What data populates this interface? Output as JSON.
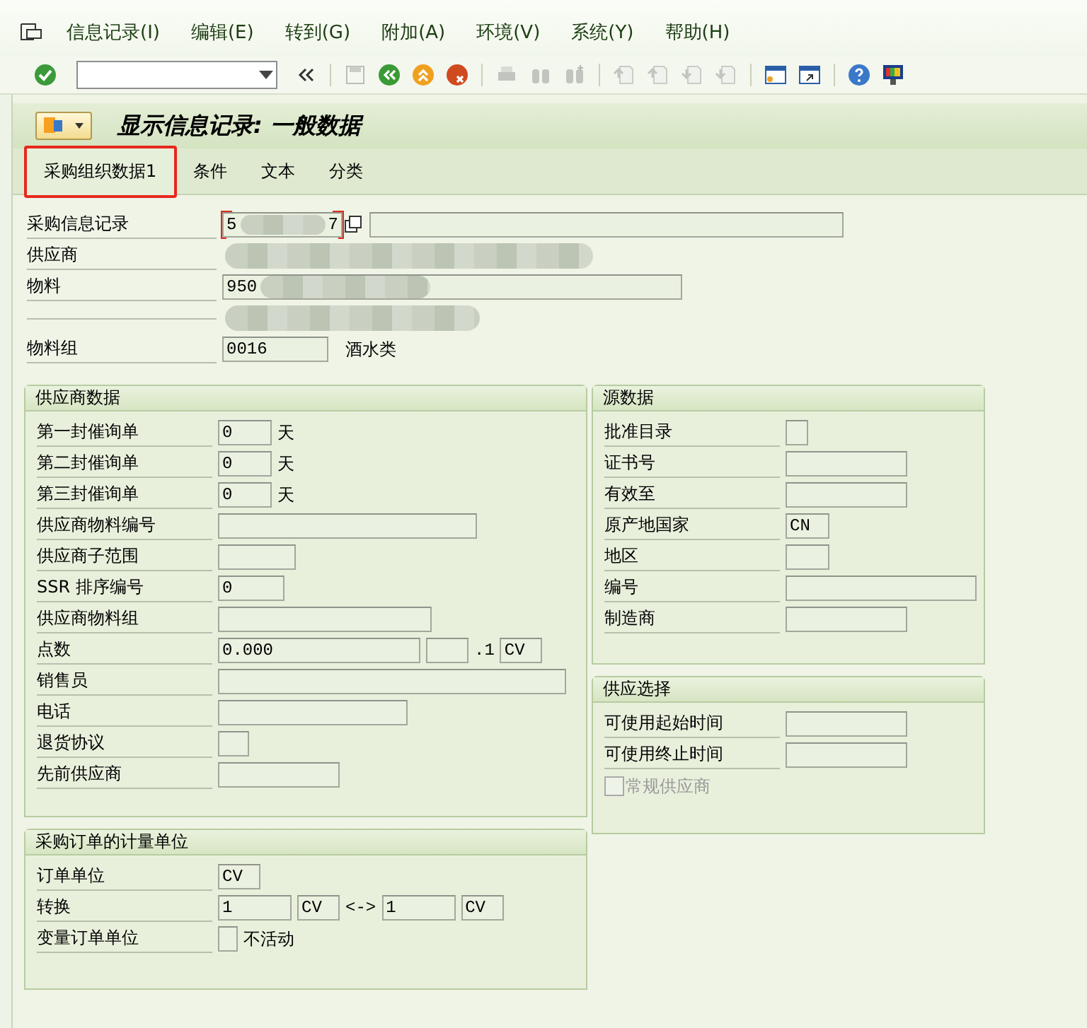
{
  "menu_bar": {
    "items": [
      {
        "label": "信息记录(I)"
      },
      {
        "label": "编辑(E)"
      },
      {
        "label": "转到(G)"
      },
      {
        "label": "附加(A)"
      },
      {
        "label": "环境(V)"
      },
      {
        "label": "系统(Y)"
      },
      {
        "label": "帮助(H)"
      }
    ]
  },
  "toolbar": {
    "buttons": [
      {
        "kind": "enter",
        "disabled": false
      },
      {
        "kind": "collapse",
        "disabled": false
      },
      {
        "kind": "save",
        "disabled": true
      },
      {
        "kind": "back",
        "disabled": false
      },
      {
        "kind": "exit",
        "disabled": false
      },
      {
        "kind": "cancel",
        "disabled": false
      },
      {
        "kind": "print",
        "disabled": true
      },
      {
        "kind": "find",
        "disabled": true
      },
      {
        "kind": "find-next",
        "disabled": true
      },
      {
        "kind": "first-page",
        "disabled": true
      },
      {
        "kind": "previous-page",
        "disabled": true
      },
      {
        "kind": "next-page",
        "disabled": true
      },
      {
        "kind": "last-page",
        "disabled": true
      },
      {
        "kind": "new-session",
        "disabled": false
      },
      {
        "kind": "shortcut",
        "disabled": false
      },
      {
        "kind": "help",
        "disabled": false
      },
      {
        "kind": "layout",
        "disabled": false
      }
    ]
  },
  "title": "显示信息记录: 一般数据",
  "tabs": [
    {
      "label": "采购组织数据1",
      "selected": true,
      "highlighted": true
    },
    {
      "label": "条件",
      "selected": false,
      "highlighted": false
    },
    {
      "label": "文本",
      "selected": false,
      "highlighted": false
    },
    {
      "label": "分类",
      "selected": false,
      "highlighted": false
    }
  ],
  "header": [
    {
      "label": "采购信息记录",
      "value_start": "5",
      "value_end": "7",
      "focused": true,
      "redacted": true
    },
    {
      "label": "供应商",
      "redacted": true
    },
    {
      "label": "物料",
      "value": "950",
      "redacted": true
    },
    {
      "redacted": true
    },
    {
      "label": "物料组",
      "value": "0016",
      "text": "酒水类"
    }
  ],
  "groups": [
    {
      "title": "供应商数据",
      "rows": [
        {
          "label": "第一封催询单",
          "parts": [
            {
              "kind": "input",
              "value": "0"
            },
            {
              "kind": "text",
              "text": "天"
            }
          ]
        },
        {
          "label": "第二封催询单",
          "parts": [
            {
              "kind": "input",
              "value": "0"
            },
            {
              "kind": "text",
              "text": "天"
            }
          ]
        },
        {
          "label": "第三封催询单",
          "parts": [
            {
              "kind": "input",
              "value": "0"
            },
            {
              "kind": "text",
              "text": "天"
            }
          ]
        },
        {
          "label": "供应商物料编号",
          "parts": [
            {
              "kind": "input"
            }
          ]
        },
        {
          "label": "供应商子范围",
          "parts": [
            {
              "kind": "input"
            }
          ]
        },
        {
          "label": "SSR 排序编号",
          "parts": [
            {
              "kind": "input",
              "value": "0"
            }
          ]
        },
        {
          "label": "供应商物料组",
          "parts": [
            {
              "kind": "input"
            }
          ]
        },
        {
          "label": "点数",
          "parts": [
            {
              "kind": "input",
              "value": "0.000"
            },
            {
              "kind": "input"
            },
            {
              "kind": "text",
              "text": ".1"
            },
            {
              "kind": "input",
              "value": "CV"
            }
          ]
        },
        {
          "label": "销售员",
          "parts": [
            {
              "kind": "input"
            }
          ]
        },
        {
          "label": "电话",
          "parts": [
            {
              "kind": "input"
            }
          ]
        },
        {
          "label": "退货协议",
          "parts": [
            {
              "kind": "input"
            }
          ]
        },
        {
          "label": "先前供应商",
          "parts": [
            {
              "kind": "input"
            }
          ]
        }
      ]
    },
    {
      "title": "源数据",
      "rows": [
        {
          "label": "批准目录",
          "parts": [
            {
              "kind": "input"
            }
          ]
        },
        {
          "label": "证书号",
          "parts": [
            {
              "kind": "input"
            }
          ]
        },
        {
          "label": "有效至",
          "parts": [
            {
              "kind": "input"
            }
          ]
        },
        {
          "label": "原产地国家",
          "parts": [
            {
              "kind": "input",
              "value": "CN"
            }
          ]
        },
        {
          "label": "地区",
          "parts": [
            {
              "kind": "input"
            }
          ]
        },
        {
          "label": "编号",
          "parts": [
            {
              "kind": "input"
            }
          ]
        },
        {
          "label": "制造商",
          "parts": [
            {
              "kind": "input"
            }
          ]
        }
      ]
    },
    {
      "title": "供应选择",
      "rows": [
        {
          "label": "可使用起始时间",
          "parts": [
            {
              "kind": "input"
            }
          ]
        },
        {
          "label": "可使用终止时间",
          "parts": [
            {
              "kind": "input"
            }
          ]
        }
      ],
      "checkbox": {
        "label": "常规供应商",
        "checked": false,
        "disabled": true
      }
    },
    {
      "title": "采购订单的计量单位",
      "rows": [
        {
          "label": "订单单位",
          "parts": [
            {
              "kind": "input",
              "value": "CV"
            }
          ]
        },
        {
          "label": "转换",
          "parts": [
            {
              "kind": "input",
              "value": "1"
            },
            {
              "kind": "input",
              "value": "CV"
            },
            {
              "kind": "text",
              "text": "<->"
            },
            {
              "kind": "input",
              "value": "1"
            },
            {
              "kind": "input",
              "value": "CV"
            }
          ]
        },
        {
          "label": "变量订单单位",
          "parts": [
            {
              "kind": "input"
            },
            {
              "kind": "text",
              "text": "不活动"
            }
          ]
        }
      ]
    }
  ]
}
